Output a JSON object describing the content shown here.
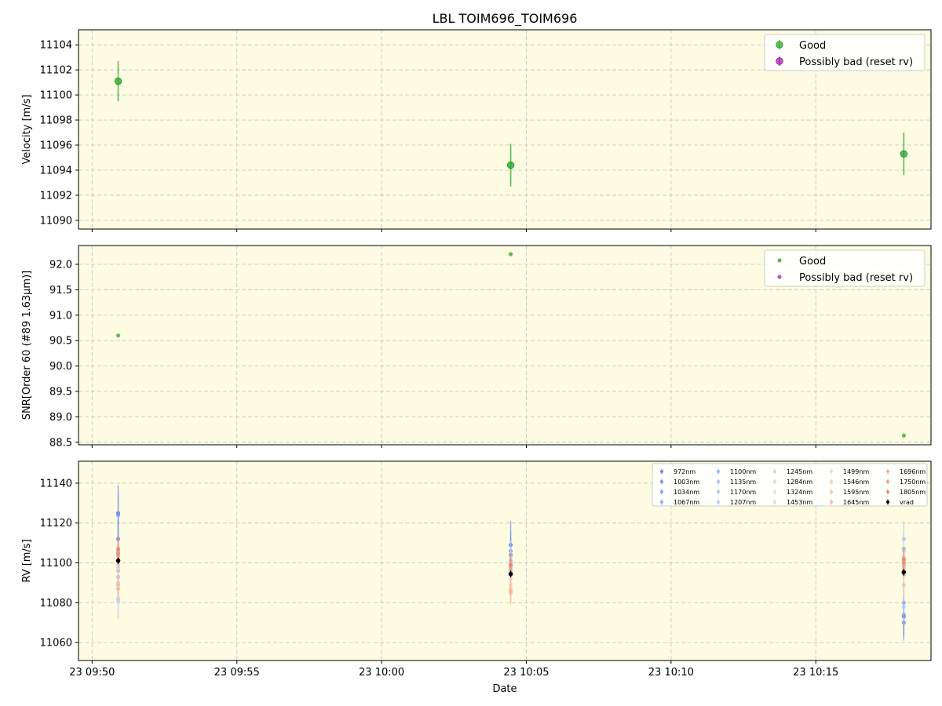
{
  "title": "LBL TOIM696_TOIM696",
  "colors": {
    "panel_bg": "#fdfbe2",
    "good": "#2ca02c",
    "bad": "#a020a0",
    "grid": "#c8c8c8",
    "vrad": "#000000"
  },
  "x_axis": {
    "label": "Date",
    "ticks": [
      "23 09:50",
      "23 09:55",
      "23 10:00",
      "23 10:05",
      "23 10:10",
      "23 10:15"
    ],
    "tick_minutes": [
      590,
      595,
      600,
      605,
      610,
      615
    ],
    "range_minutes": [
      589.53,
      618.98
    ]
  },
  "chart_data": [
    {
      "type": "scatter",
      "ylabel": "Velocity [m/s]",
      "ylim": [
        11089.3,
        11105.2
      ],
      "yticks": [
        11090,
        11092,
        11094,
        11096,
        11098,
        11100,
        11102,
        11104
      ],
      "x_minutes": [
        590.9,
        604.46,
        618.04
      ],
      "series": [
        {
          "name": "Good",
          "values": [
            11101.1,
            11094.4,
            11095.3
          ],
          "errors": [
            1.6,
            1.7,
            1.7
          ]
        },
        {
          "name": "Possibly bad (reset rv)",
          "values": [],
          "errors": []
        }
      ],
      "legend": "top-right",
      "grid": true
    },
    {
      "type": "scatter",
      "ylabel": "SNR[Order 60 (#89 1.63μm)]",
      "ylim": [
        88.45,
        92.37
      ],
      "yticks": [
        88.5,
        89.0,
        89.5,
        90.0,
        90.5,
        91.0,
        91.5,
        92.0
      ],
      "ytick_labels": [
        "88.5",
        "89.0",
        "89.5",
        "90.0",
        "90.5",
        "91.0",
        "91.5",
        "92.0"
      ],
      "x_minutes": [
        590.9,
        604.46,
        618.04
      ],
      "series": [
        {
          "name": "Good",
          "values": [
            90.6,
            92.2,
            88.63
          ]
        },
        {
          "name": "Possibly bad (reset rv)",
          "values": []
        }
      ],
      "legend": "top-right",
      "grid": true
    },
    {
      "type": "scatter",
      "ylabel": "RV [m/s]",
      "xlabel": "Date",
      "ylim": [
        11051,
        11151
      ],
      "yticks": [
        11060,
        11080,
        11100,
        11120,
        11140
      ],
      "x_minutes": [
        590.9,
        604.46,
        618.04
      ],
      "legend": "top-right",
      "grid": true,
      "series": [
        {
          "name": "972nm",
          "color": "#5673e0",
          "values": [
            11125,
            11109,
            11073
          ],
          "errors": [
            14,
            12,
            10
          ]
        },
        {
          "name": "1003nm",
          "color": "#6282ea",
          "values": [
            11112,
            11104,
            11070
          ],
          "errors": [
            10,
            9,
            9
          ]
        },
        {
          "name": "1034nm",
          "color": "#6f92f3",
          "values": [
            11124,
            11106,
            11074
          ],
          "errors": [
            12,
            10,
            8
          ]
        },
        {
          "name": "1067nm",
          "color": "#7b9ff9",
          "values": [
            11105,
            11101,
            11080
          ],
          "errors": [
            10,
            8,
            9
          ]
        },
        {
          "name": "1100nm",
          "color": "#88abfd",
          "values": [
            11096,
            11099,
            11107
          ],
          "errors": [
            8,
            7,
            8
          ]
        },
        {
          "name": "1135nm",
          "color": "#96b7ff",
          "values": [
            11093,
            11097,
            11100
          ],
          "errors": [
            8,
            7,
            7
          ]
        },
        {
          "name": "1170nm",
          "color": "#a3c2fe",
          "values": [
            11089,
            11096,
            11112
          ],
          "errors": [
            9,
            8,
            9
          ]
        },
        {
          "name": "1207nm",
          "color": "#b1cbfc",
          "values": [
            11081,
            11095,
            11078
          ],
          "errors": [
            9,
            9,
            9
          ]
        },
        {
          "name": "1245nm",
          "color": "#bed2f6",
          "values": [
            11082,
            11103,
            11106
          ],
          "errors": [
            10,
            8,
            8
          ]
        },
        {
          "name": "1284nm",
          "color": "#cad8ef",
          "values": [
            11098,
            11098,
            11099
          ],
          "errors": [
            8,
            8,
            8
          ]
        },
        {
          "name": "1324nm",
          "color": "#d5dbe5",
          "values": [
            11099,
            11100,
            11103
          ],
          "errors": [
            8,
            7,
            8
          ]
        },
        {
          "name": "1453nm",
          "color": "#e5d8d1",
          "values": [
            11100,
            11092,
            11097
          ],
          "errors": [
            8,
            7,
            8
          ]
        },
        {
          "name": "1499nm",
          "color": "#eed0c0",
          "values": [
            11097,
            11089,
            11094
          ],
          "errors": [
            8,
            7,
            7
          ]
        },
        {
          "name": "1546nm",
          "color": "#f3c7b1",
          "values": [
            11103,
            11087,
            11099
          ],
          "errors": [
            7,
            7,
            7
          ]
        },
        {
          "name": "1595nm",
          "color": "#f6bda2",
          "values": [
            11090,
            11086,
            11089
          ],
          "errors": [
            7,
            6,
            7
          ]
        },
        {
          "name": "1645nm",
          "color": "#f5b194",
          "values": [
            11087,
            11085,
            11098
          ],
          "errors": [
            6,
            6,
            6
          ]
        },
        {
          "name": "1696nm",
          "color": "#f2a385",
          "values": [
            11106,
            11098,
            11101
          ],
          "errors": [
            6,
            6,
            6
          ]
        },
        {
          "name": "1750nm",
          "color": "#ec9475",
          "values": [
            11104,
            11099,
            11100
          ],
          "errors": [
            6,
            6,
            6
          ]
        },
        {
          "name": "1805nm",
          "color": "#e48066",
          "values": [
            11107,
            11099,
            11102
          ],
          "errors": [
            6,
            6,
            6
          ]
        },
        {
          "name": "vrad",
          "color": "#000000",
          "values": [
            11101.1,
            11094.4,
            11095.3
          ],
          "errors": [
            1.6,
            1.7,
            1.7
          ]
        }
      ]
    }
  ]
}
